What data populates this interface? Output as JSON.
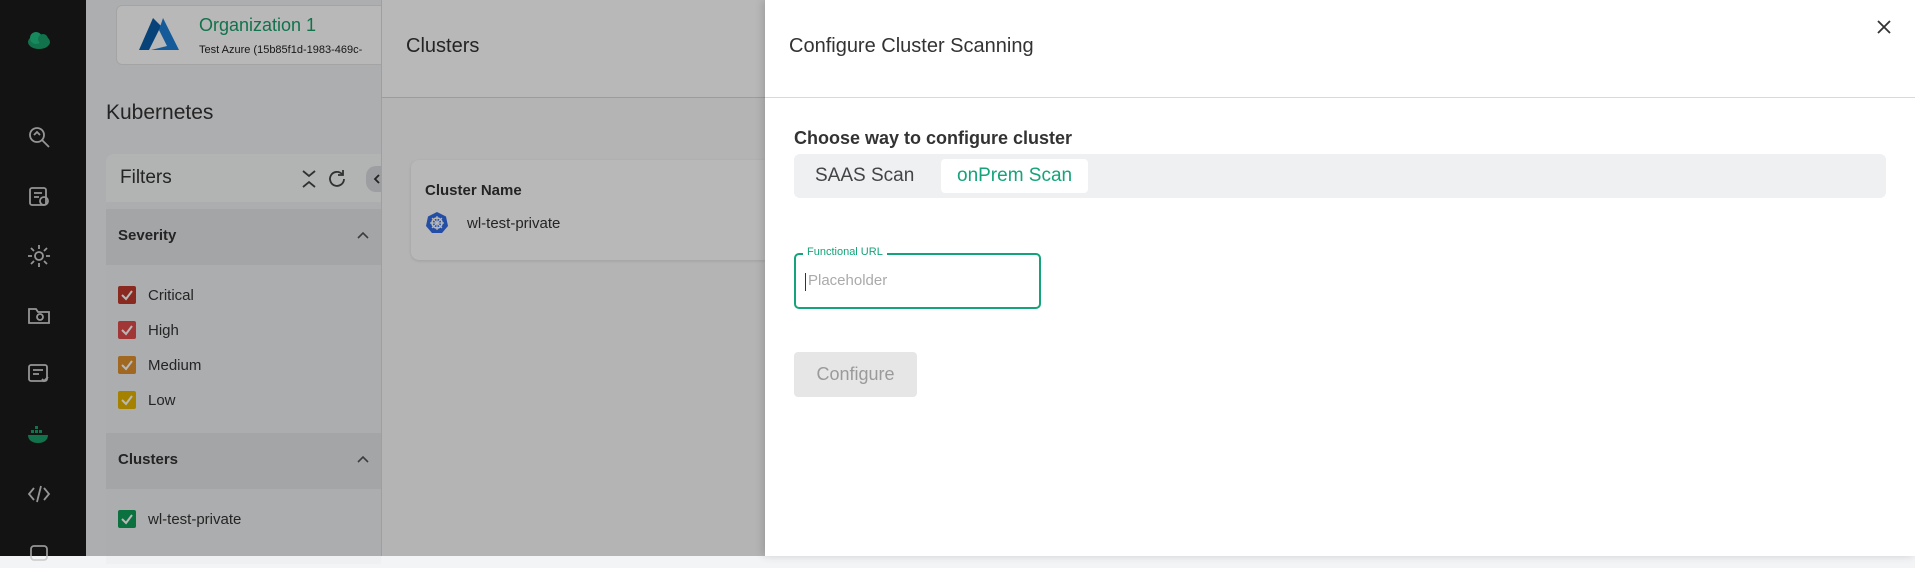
{
  "org": {
    "name": "Organization 1",
    "subtitle": "Test Azure  (15b85f1d-1983-469c-"
  },
  "page": {
    "title": "Kubernetes"
  },
  "filters": {
    "title": "Filters",
    "severity": {
      "title": "Severity",
      "items": [
        {
          "label": "Critical",
          "color": "#c0392b",
          "checked": true
        },
        {
          "label": "High",
          "color": "#e04b4b",
          "checked": true
        },
        {
          "label": "Medium",
          "color": "#e0912f",
          "checked": true
        },
        {
          "label": "Low",
          "color": "#e4b400",
          "checked": true
        }
      ]
    },
    "clusters": {
      "title": "Clusters",
      "items": [
        {
          "label": "wl-test-private",
          "color": "#0f9d58",
          "checked": true
        }
      ]
    }
  },
  "clusters_panel": {
    "title": "Clusters",
    "column": "Cluster Name",
    "row": "wl-test-private"
  },
  "drawer": {
    "title": "Configure Cluster Scanning",
    "choose_label": "Choose way to configure cluster",
    "options": [
      "SAAS Scan",
      "onPrem Scan"
    ],
    "selected_option": "onPrem Scan",
    "field": {
      "label": "Functional URL",
      "placeholder": "Placeholder",
      "value": ""
    },
    "configure_label": "Configure"
  },
  "colors": {
    "accent": "#14a37a",
    "rail": "#1b1b1b"
  },
  "rail_icons": [
    "cloud-logo-icon",
    "search-scan-icon",
    "report-icon",
    "settings-gear-icon",
    "folder-icon",
    "checklist-icon",
    "docker-icon",
    "code-icon",
    "robot-icon"
  ]
}
